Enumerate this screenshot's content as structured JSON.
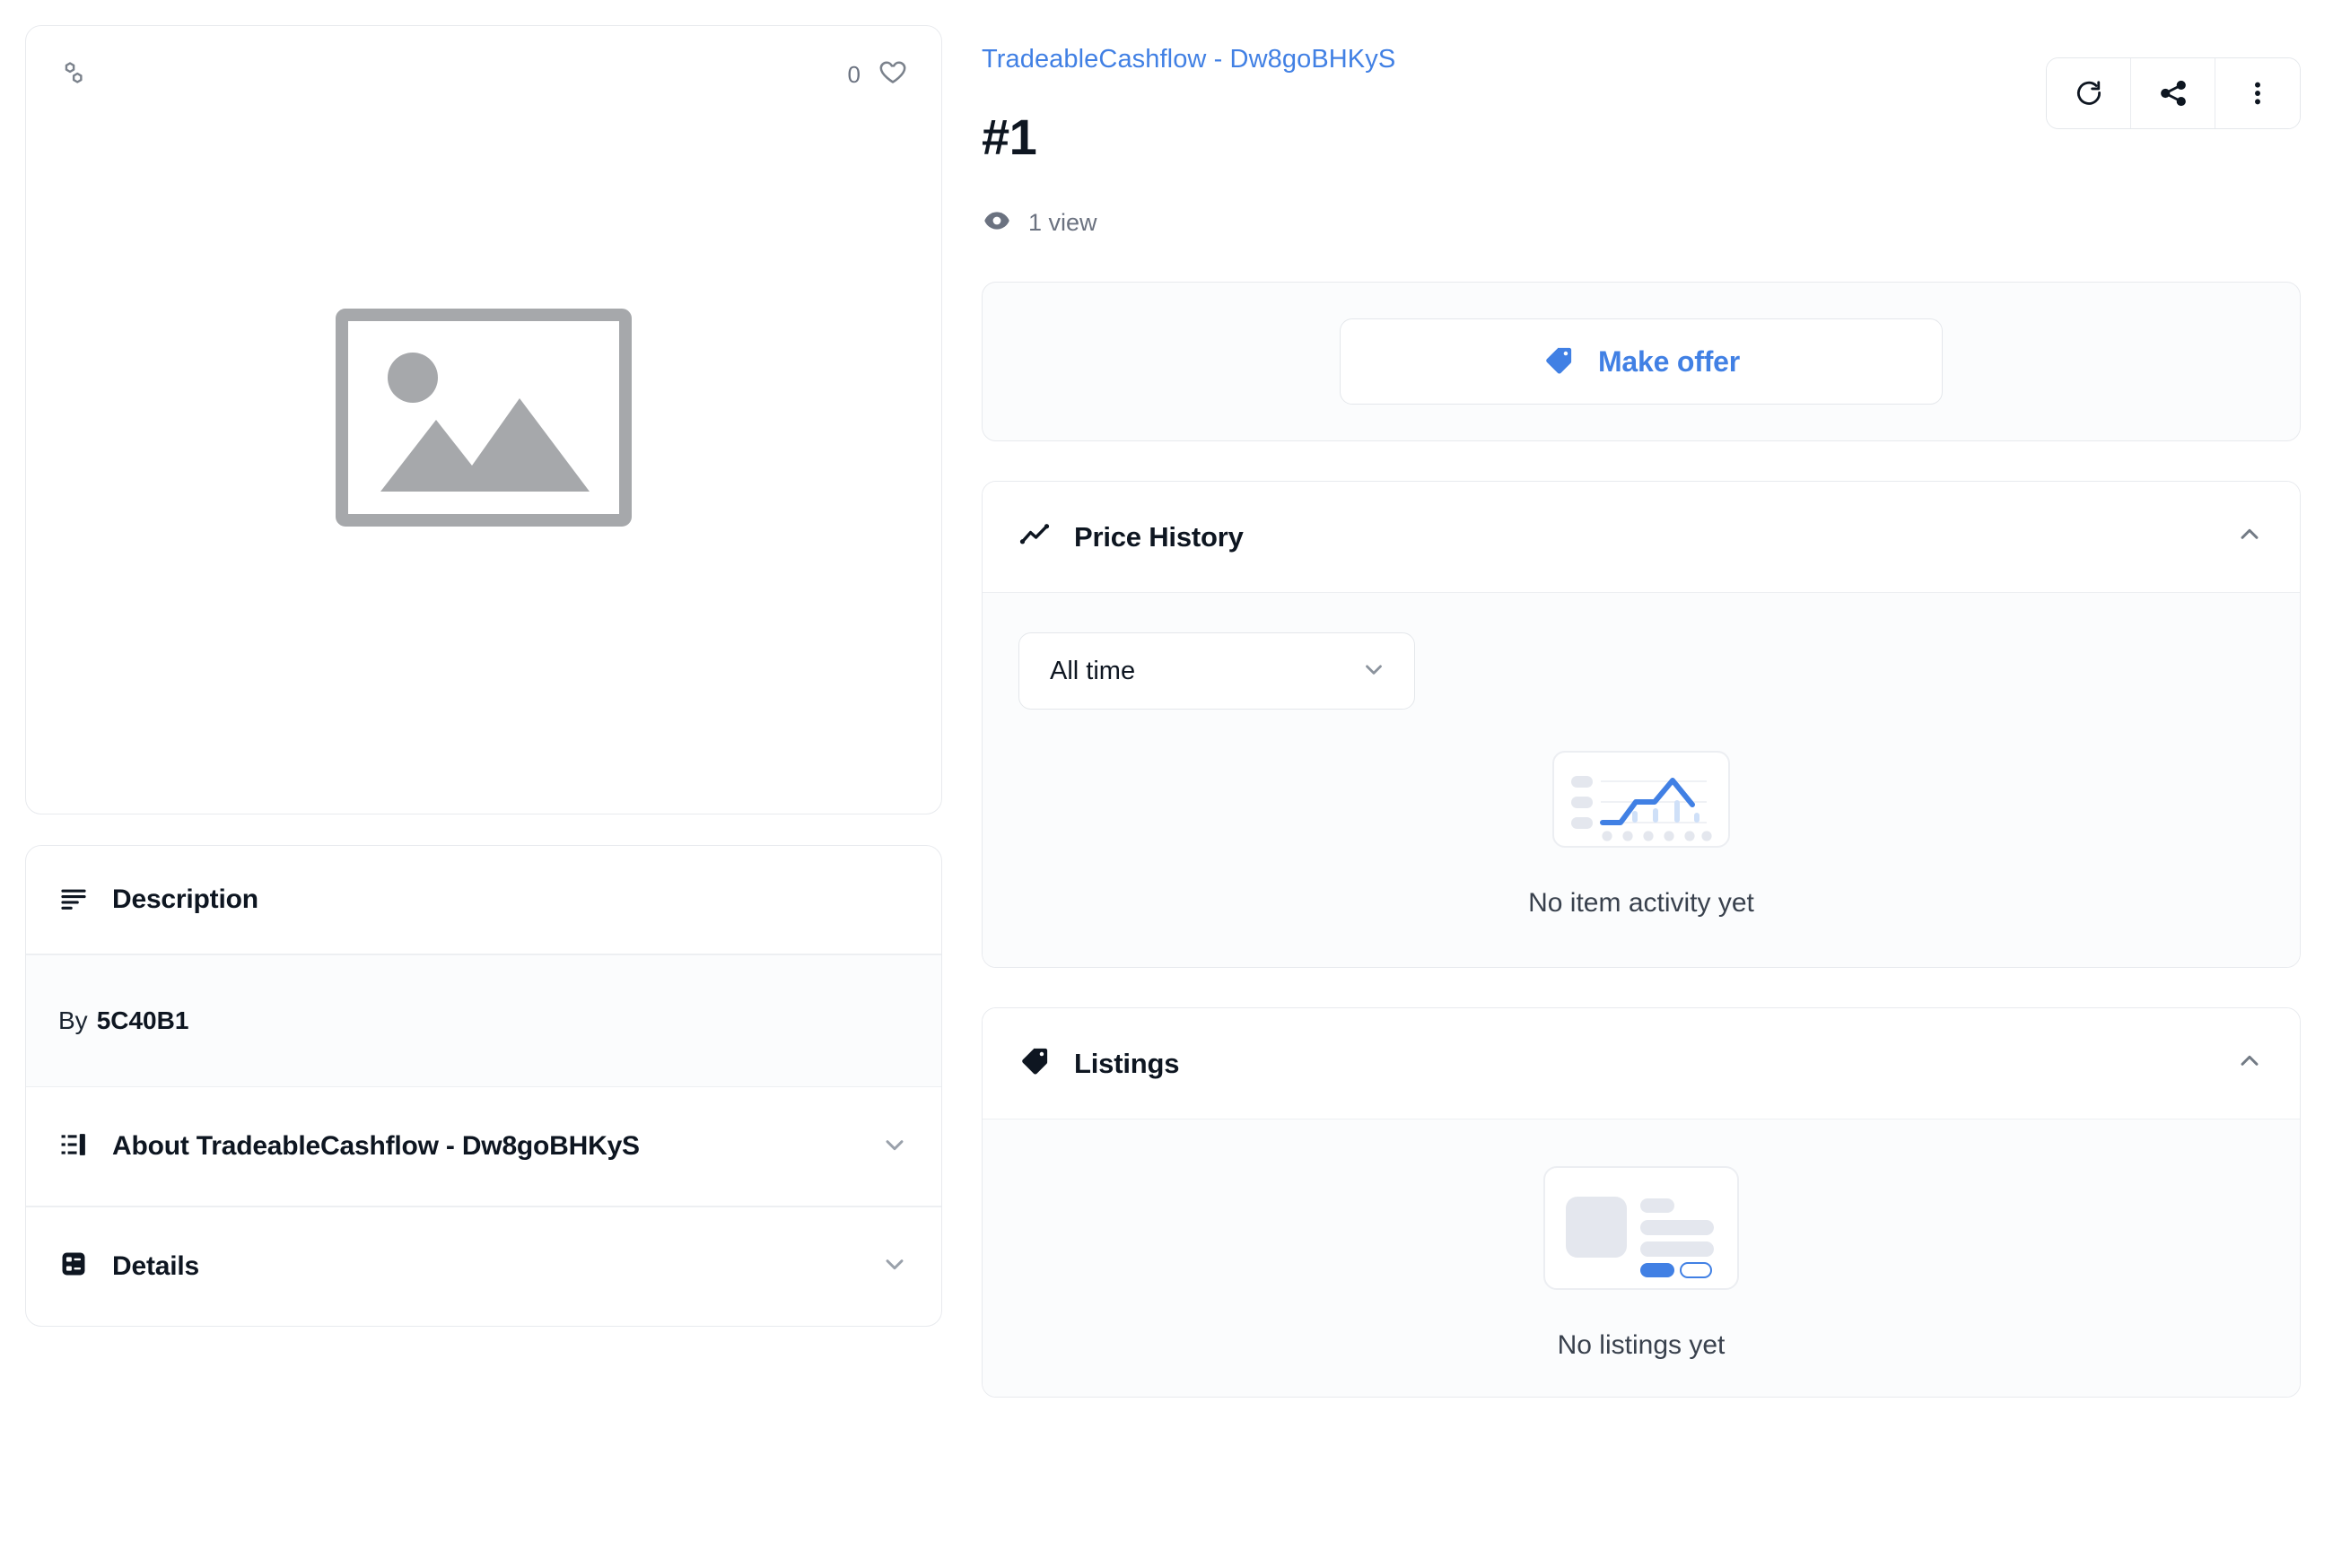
{
  "theme": {
    "accent_blue": "#4180e4",
    "text_dark": "#0e1621",
    "text_muted": "#6b7280",
    "border": "#e8eaee",
    "panel_bg": "#fbfcfd"
  },
  "media": {
    "chain_icon": "chain-link-icon",
    "like_count": "0",
    "like_icon": "heart-outline-icon",
    "placeholder_icon": "image-placeholder-icon"
  },
  "description_card": {
    "header": {
      "icon": "text-lines-icon",
      "title": "Description"
    },
    "by_label": "By",
    "by_value": "5C40B1",
    "accordions": [
      {
        "icon": "list-detail-icon",
        "title": "About TradeableCashflow - Dw8goBHKyS",
        "chevron": "chevron-down-icon",
        "expanded": false
      },
      {
        "icon": "properties-grid-icon",
        "title": "Details",
        "chevron": "chevron-down-icon",
        "expanded": false
      }
    ]
  },
  "header": {
    "collection_name": "TradeableCashflow - Dw8goBHKyS",
    "item_title": "#1",
    "views_icon": "eye-icon",
    "views_text": "1 view",
    "actions": [
      {
        "name": "refresh-metadata-button",
        "icon": "refresh-icon"
      },
      {
        "name": "share-button",
        "icon": "share-icon"
      },
      {
        "name": "more-options-button",
        "icon": "kebab-menu-icon"
      }
    ]
  },
  "offer": {
    "icon": "tag-icon",
    "label": "Make offer"
  },
  "price_history": {
    "icon": "line-chart-icon",
    "title": "Price History",
    "chevron": "chevron-up-icon",
    "expanded": true,
    "time_filter": {
      "selected": "All time",
      "chevron": "chevron-down-icon"
    },
    "empty_illustration": "chart-skeleton-illustration",
    "empty_text": "No item activity yet"
  },
  "listings": {
    "icon": "tag-filled-icon",
    "title": "Listings",
    "chevron": "chevron-up-icon",
    "expanded": true,
    "empty_illustration": "listing-card-skeleton-illustration",
    "empty_text": "No listings yet"
  }
}
